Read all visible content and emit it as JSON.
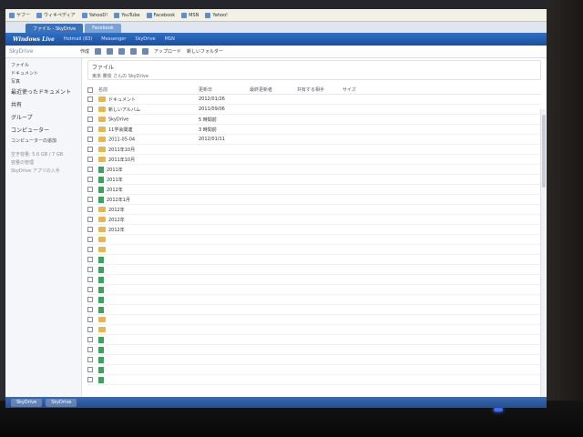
{
  "browser": {
    "favorites": [
      "ヤフー",
      "ウィキペディア",
      "YahooD!",
      "YouTube",
      "Facebook",
      "MSN",
      "Yahoo!"
    ],
    "tabs": [
      {
        "label": "ファイル - SkyDrive"
      },
      {
        "label": "Facebook"
      }
    ]
  },
  "live_header": {
    "logo": "Windows Live",
    "nav": [
      "Hotmail (83)",
      "Messenger",
      "SkyDrive",
      "MSN"
    ]
  },
  "sub_header": {
    "title": "SkyDrive",
    "actions": [
      "作成",
      "アップロード",
      "新しいフォルダー"
    ]
  },
  "sidebar": {
    "items": [
      {
        "label": "ファイル"
      },
      {
        "label": "ドキュメント"
      },
      {
        "label": "写真"
      },
      {
        "label": "最近使ったドキュメント"
      },
      {
        "label": "共有"
      },
      {
        "label": "グループ"
      },
      {
        "label": "コンピューター"
      },
      {
        "label": "コンピューターの追加"
      },
      {
        "label": "空き容量: 5.6 GB / 7 GB"
      },
      {
        "label": "容量の管理"
      },
      {
        "label": "SkyDrive アプリの入手"
      }
    ]
  },
  "main": {
    "path_title": "ファイル",
    "path_sub": "東京 勝俊 さんの SkyDrive",
    "columns": {
      "name": "名前",
      "date": "更新日",
      "owner": "最終更新者",
      "share": "共有する相手",
      "size": "サイズ"
    },
    "rows": [
      {
        "kind": "folder",
        "name": "ドキュメント",
        "date": "2012/01/26",
        "owner": "",
        "share": "",
        "size": ""
      },
      {
        "kind": "folder",
        "name": "新しいアルバム",
        "date": "2011/09/06",
        "owner": "",
        "share": "",
        "size": ""
      },
      {
        "kind": "folder",
        "name": "SkyDrive",
        "date": "5 時間前",
        "owner": "",
        "share": "",
        "size": ""
      },
      {
        "kind": "folder",
        "name": "11学会関連",
        "date": "3 時間前",
        "owner": "",
        "share": "",
        "size": ""
      },
      {
        "kind": "folder",
        "name": "2011-05-04",
        "date": "2012/01/11",
        "owner": "",
        "share": "",
        "size": ""
      },
      {
        "kind": "folder",
        "name": "2011年10月",
        "date": "",
        "owner": "",
        "share": "",
        "size": ""
      },
      {
        "kind": "folder",
        "name": "2011年10月",
        "date": "",
        "owner": "",
        "share": "",
        "size": ""
      },
      {
        "kind": "file",
        "name": "2011年",
        "date": "",
        "owner": "",
        "share": "",
        "size": ""
      },
      {
        "kind": "file",
        "name": "2011年",
        "date": "",
        "owner": "",
        "share": "",
        "size": ""
      },
      {
        "kind": "file",
        "name": "2012年",
        "date": "",
        "owner": "",
        "share": "",
        "size": ""
      },
      {
        "kind": "file",
        "name": "2012年1月",
        "date": "",
        "owner": "",
        "share": "",
        "size": ""
      },
      {
        "kind": "folder",
        "name": "2012年",
        "date": "",
        "owner": "",
        "share": "",
        "size": ""
      },
      {
        "kind": "folder",
        "name": "2012年",
        "date": "",
        "owner": "",
        "share": "",
        "size": ""
      },
      {
        "kind": "folder",
        "name": "2012年",
        "date": "",
        "owner": "",
        "share": "",
        "size": ""
      },
      {
        "kind": "folder",
        "name": "",
        "date": "",
        "owner": "",
        "share": "",
        "size": ""
      },
      {
        "kind": "folder",
        "name": "",
        "date": "",
        "owner": "",
        "share": "",
        "size": ""
      },
      {
        "kind": "file",
        "name": "",
        "date": "",
        "owner": "",
        "share": "",
        "size": ""
      },
      {
        "kind": "file",
        "name": "",
        "date": "",
        "owner": "",
        "share": "",
        "size": ""
      },
      {
        "kind": "file",
        "name": "",
        "date": "",
        "owner": "",
        "share": "",
        "size": ""
      },
      {
        "kind": "file",
        "name": "",
        "date": "",
        "owner": "",
        "share": "",
        "size": ""
      },
      {
        "kind": "file",
        "name": "",
        "date": "",
        "owner": "",
        "share": "",
        "size": ""
      },
      {
        "kind": "file",
        "name": "",
        "date": "",
        "owner": "",
        "share": "",
        "size": ""
      },
      {
        "kind": "folder",
        "name": "",
        "date": "",
        "owner": "",
        "share": "",
        "size": ""
      },
      {
        "kind": "folder",
        "name": "",
        "date": "",
        "owner": "",
        "share": "",
        "size": ""
      },
      {
        "kind": "file",
        "name": "",
        "date": "",
        "owner": "",
        "share": "",
        "size": ""
      },
      {
        "kind": "file",
        "name": "",
        "date": "",
        "owner": "",
        "share": "",
        "size": ""
      },
      {
        "kind": "file",
        "name": "",
        "date": "",
        "owner": "",
        "share": "",
        "size": ""
      },
      {
        "kind": "file",
        "name": "",
        "date": "",
        "owner": "",
        "share": "",
        "size": ""
      },
      {
        "kind": "file",
        "name": "",
        "date": "",
        "owner": "",
        "share": "",
        "size": ""
      }
    ]
  },
  "taskbar": {
    "items": [
      "SkyDrive",
      "SkyDrive"
    ]
  }
}
